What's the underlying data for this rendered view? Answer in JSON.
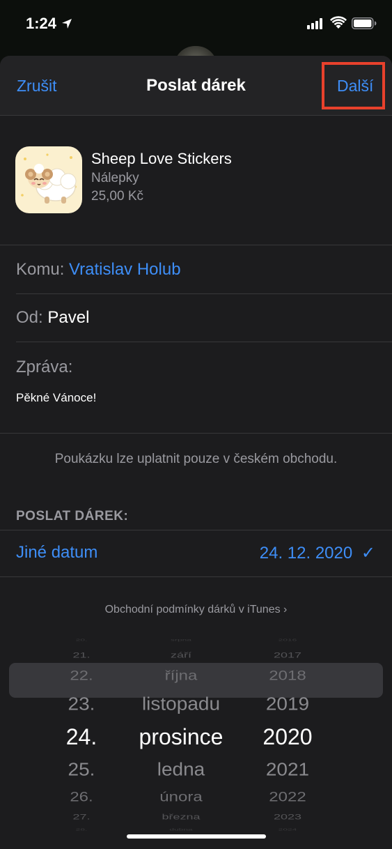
{
  "status_bar": {
    "time": "1:24"
  },
  "nav": {
    "cancel": "Zrušit",
    "title": "Poslat dárek",
    "next": "Další"
  },
  "product": {
    "name": "Sheep Love Stickers",
    "category": "Nálepky",
    "price": "25,00 Kč"
  },
  "to": {
    "label": "Komu:",
    "value": "Vratislav Holub"
  },
  "from": {
    "label": "Od:",
    "value": "Pavel"
  },
  "message": {
    "label": "Zpráva:",
    "value": "Pěkné Vánoce!"
  },
  "notice": "Poukázku lze uplatnit pouze v českém obchodu.",
  "send_section": {
    "header": "POSLAT DÁREK:",
    "option_label": "Jiné datum",
    "date_value": "24. 12. 2020",
    "check": "✓"
  },
  "terms_link": "Obchodní podmínky dárků v iTunes",
  "terms_chevron": "›",
  "picker": {
    "days": [
      "20.",
      "21.",
      "22.",
      "23.",
      "24.",
      "25.",
      "26.",
      "27.",
      "28."
    ],
    "months": [
      "srpna",
      "září",
      "října",
      "listopadu",
      "prosince",
      "ledna",
      "února",
      "března",
      "dubna"
    ],
    "years": [
      "2016",
      "2017",
      "2018",
      "2019",
      "2020",
      "2021",
      "2022",
      "2023",
      "2024"
    ],
    "selected_index": 4
  },
  "colors": {
    "accent": "#3e8ef7",
    "highlight": "#e8412c",
    "sheet": "#1c1c1e"
  }
}
